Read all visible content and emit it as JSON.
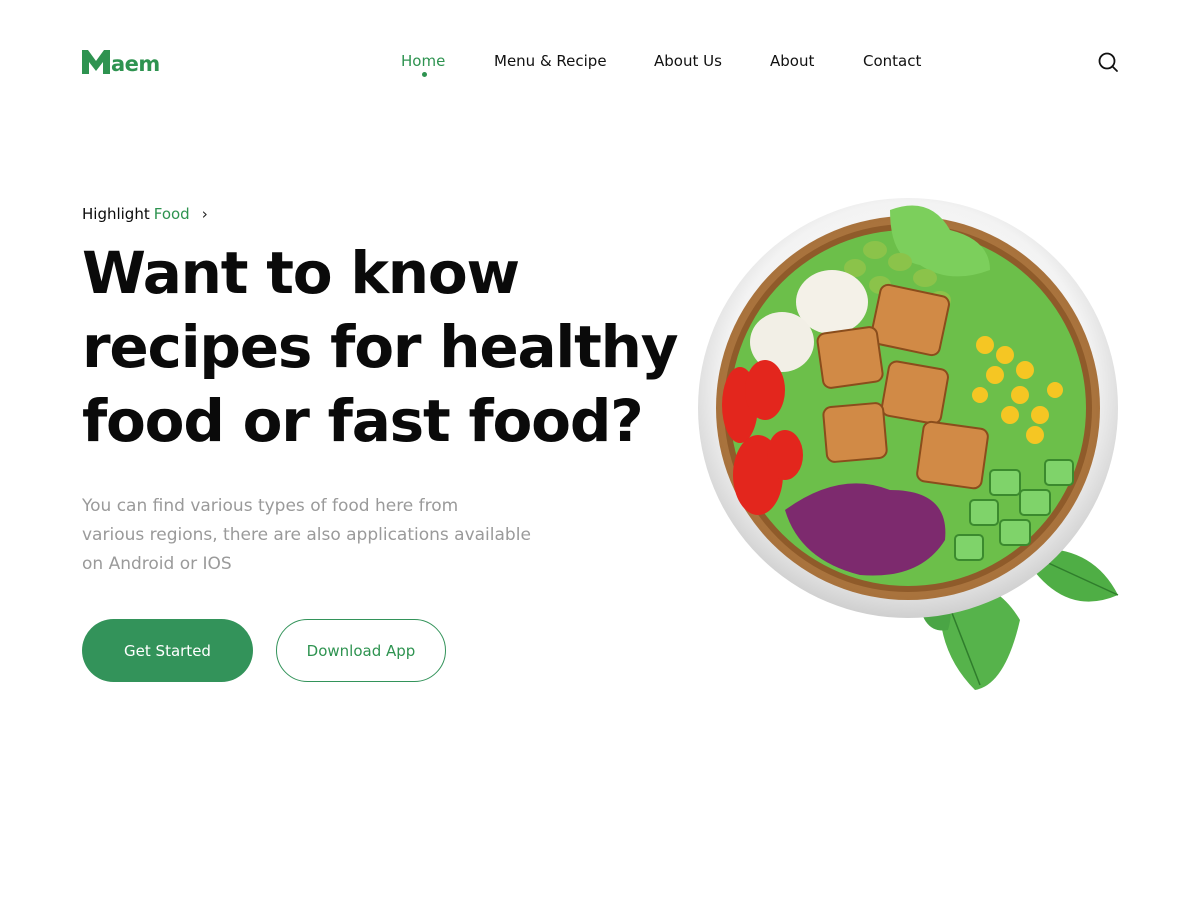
{
  "brand": {
    "name": "aem",
    "accent_color": "#2e9350"
  },
  "nav": {
    "items": [
      {
        "label": "Home",
        "active": true
      },
      {
        "label": "Menu & Recipe",
        "active": false
      },
      {
        "label": "About Us",
        "active": false
      },
      {
        "label": "About",
        "active": false
      },
      {
        "label": "Contact",
        "active": false
      }
    ],
    "search_icon": "search-icon"
  },
  "hero": {
    "breadcrumb": {
      "prefix": "Highlight",
      "accent": "Food",
      "chevron": "›"
    },
    "headline_lines": [
      "Want to know",
      "recipes for healthy",
      "food or fast food?"
    ],
    "description_lines": [
      "You can find various types of food here from",
      "various regions, there are also applications available",
      "on Android or IOS"
    ],
    "primary_button": "Get Started",
    "secondary_button": "Download App",
    "primary_color": "#33935a"
  },
  "illustration": {
    "subject": "salad-bowl-image"
  }
}
